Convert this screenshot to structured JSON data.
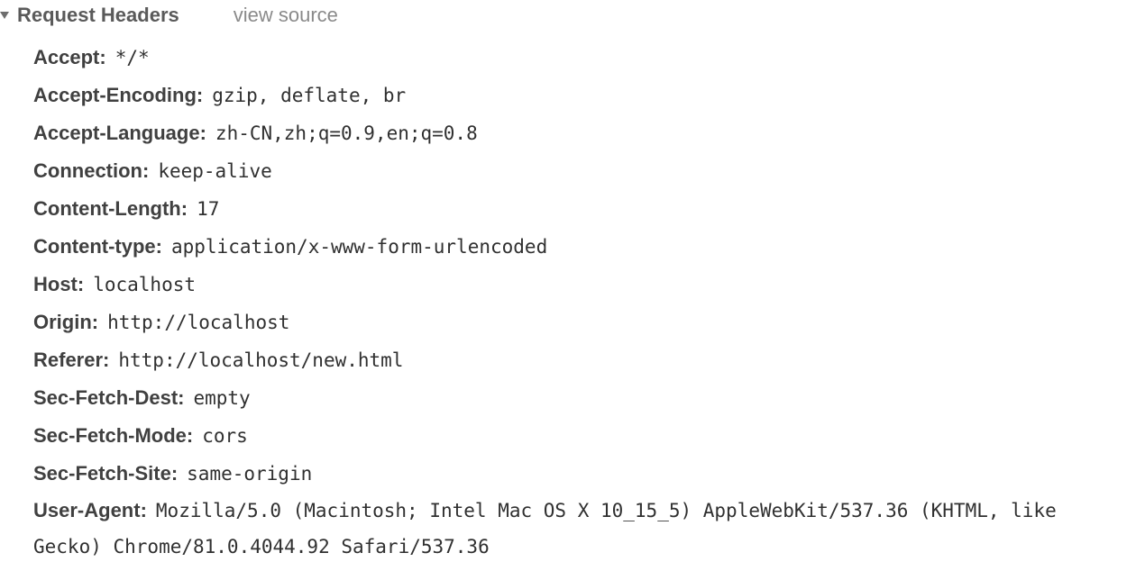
{
  "section": {
    "title": "Request Headers",
    "view_source_label": "view source",
    "toggle_icon": "triangle-down-icon"
  },
  "headers": [
    {
      "name": "Accept",
      "value": "*/*"
    },
    {
      "name": "Accept-Encoding",
      "value": "gzip, deflate, br"
    },
    {
      "name": "Accept-Language",
      "value": "zh-CN,zh;q=0.9,en;q=0.8"
    },
    {
      "name": "Connection",
      "value": "keep-alive"
    },
    {
      "name": "Content-Length",
      "value": "17"
    },
    {
      "name": "Content-type",
      "value": "application/x-www-form-urlencoded"
    },
    {
      "name": "Host",
      "value": "localhost"
    },
    {
      "name": "Origin",
      "value": "http://localhost"
    },
    {
      "name": "Referer",
      "value": "http://localhost/new.html"
    },
    {
      "name": "Sec-Fetch-Dest",
      "value": "empty"
    },
    {
      "name": "Sec-Fetch-Mode",
      "value": "cors"
    },
    {
      "name": "Sec-Fetch-Site",
      "value": "same-origin"
    },
    {
      "name": "User-Agent",
      "value": "Mozilla/5.0 (Macintosh; Intel Mac OS X 10_15_5) AppleWebKit/537.36 (KHTML, like Gecko) Chrome/81.0.4044.92 Safari/537.36"
    }
  ],
  "separator": ":"
}
